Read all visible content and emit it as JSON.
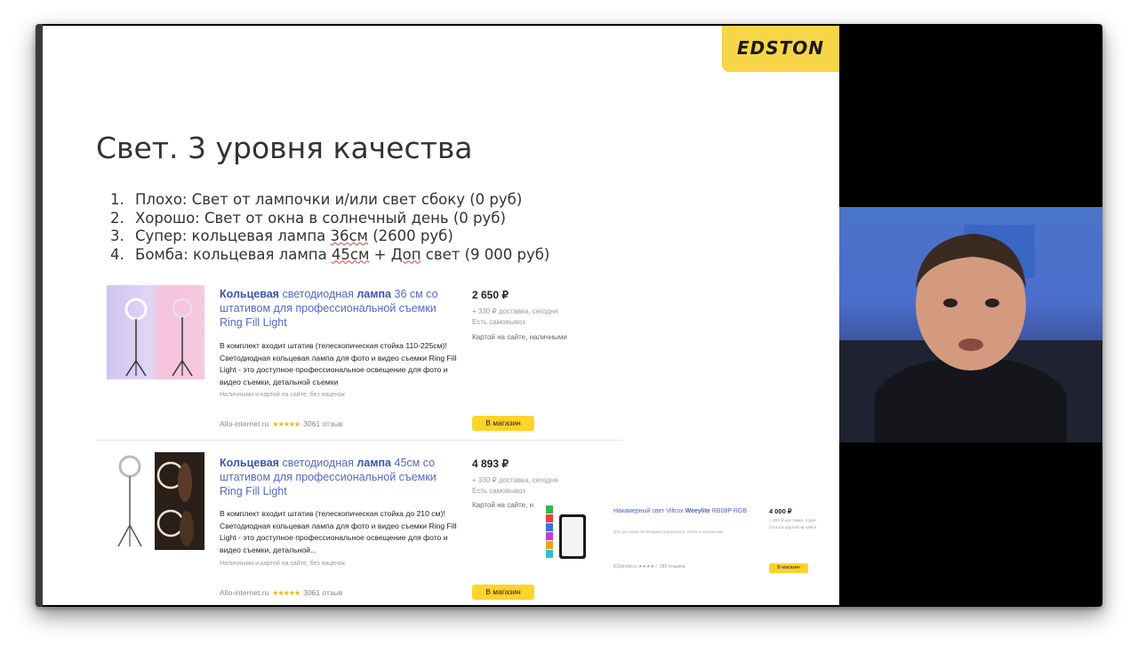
{
  "logo": {
    "text": "EDSTON"
  },
  "slide": {
    "title": "Свет. 3 уровня качества",
    "items": [
      {
        "num": "1.",
        "text": "Плохо: Свет от лампочки и/или свет сбоку (0 руб)"
      },
      {
        "num": "2.",
        "text": "Хорошо: Свет от окна в солнечный день (0 руб)"
      },
      {
        "num": "3.",
        "pre": "Супер: кольцевая лампа ",
        "sq": "36см",
        "post": " (2600 руб)"
      },
      {
        "num": "4.",
        "pre": "Бомба: кольцевая лампа ",
        "sq": "45см",
        "mid": " + ",
        "sq2": "Доп",
        "post": " свет (9 000 руб)"
      }
    ]
  },
  "products": [
    {
      "title_bold1": "Кольцевая",
      "title_mid": " светодиодная ",
      "title_bold2": "лампа",
      "title_rest": " 36 см со штативом для профессиональной съемки Ring Fill Light",
      "desc": "В комплект входит штатив (телескопическая стойка 110-225см)! Светодиодная кольцевая лампа для фото и видео съемки Ring Fill Light - это доступное профессиональное освещение для фото и видео съемки, детальной съемки",
      "note": "Наличными и картой на сайте, без наценок",
      "seller": "Allo-internet.ru",
      "stars": "★★★★★",
      "reviews": "3061 отзыв",
      "price": "2 650 ₽",
      "delivery": "+ 330 ₽ доставка, сегодня",
      "pickup": "Есть самовывоз",
      "payment": "Картой на сайте, наличными",
      "button": "В магазин"
    },
    {
      "title_bold1": "Кольцевая",
      "title_mid": " светодиодная ",
      "title_bold2": "лампа",
      "title_rest": " 45см со штативом для профессиональной съемки Ring Fill Light",
      "desc": "В комплект входит штатив (телескопическая стойка до 210 см)! Светодиодная кольцевая лампа для фото и видео съемки Ring Fill Light - это доступное профессиональное освещение для фото и видео съемки, детальной...",
      "note": "Наличными и картой на сайте, без наценок",
      "seller": "Allo-internet.ru",
      "stars": "★★★★★",
      "reviews": "3061 отзыв",
      "price": "4 893 ₽",
      "delivery": "+ 330 ₽ доставка, сегодня",
      "pickup": "Есть самовывоз",
      "payment": "Картой на сайте, н",
      "button": "В магазин"
    }
  ],
  "mini_product": {
    "title_pre": "Накамерный свет Viltrox ",
    "title_bold": "Weeylite",
    "title_rest": " RB08P RGB",
    "desc": "Для доставки необходимо предоплата. Оплата наличными",
    "seller": "812photo.ru ★★★★☆ 289 отзывов",
    "price": "4 000 ₽",
    "delivery": "+ 400 ₽ доставка, 2 дня",
    "payment": "Оплата картой на сайте",
    "button": "В магазин"
  }
}
